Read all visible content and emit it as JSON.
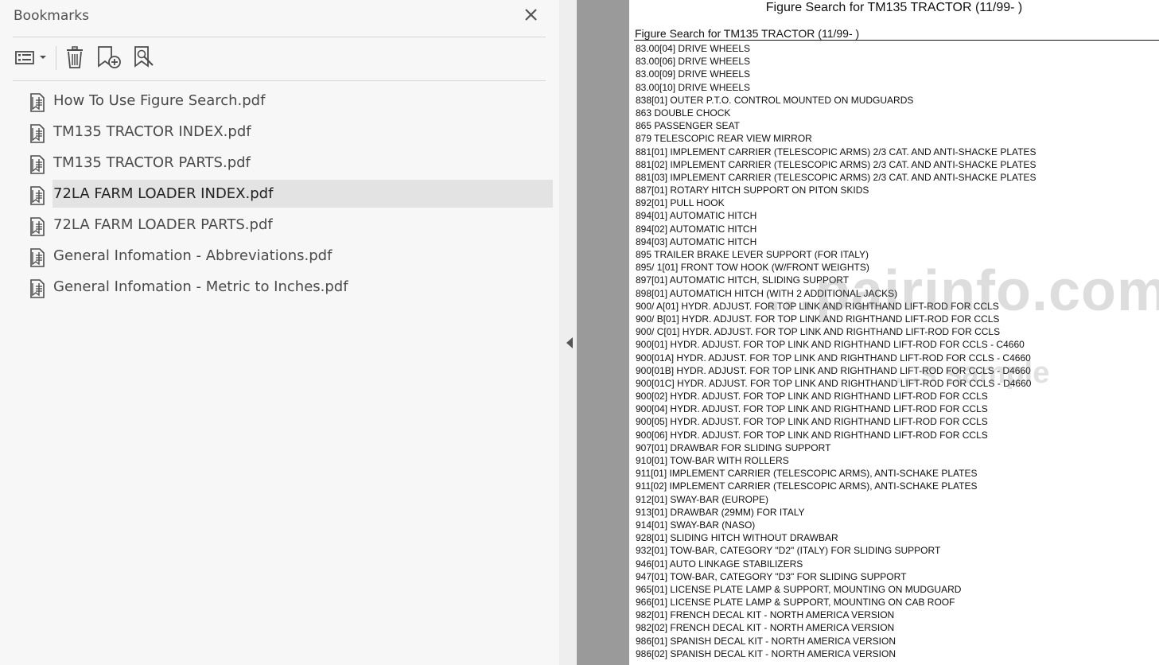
{
  "bookmarks_panel": {
    "title": "Bookmarks",
    "toolbar": [
      {
        "icon": "options-list-icon"
      },
      {
        "icon": "delete-trash-icon"
      },
      {
        "icon": "new-bookmark-icon"
      },
      {
        "icon": "find-bookmark-icon"
      }
    ],
    "items": [
      {
        "label": "How To Use Figure Search.pdf",
        "selected": false
      },
      {
        "label": "TM135 TRACTOR INDEX.pdf",
        "selected": false
      },
      {
        "label": "TM135 TRACTOR PARTS.pdf",
        "selected": false
      },
      {
        "label": "72LA FARM LOADER INDEX.pdf",
        "selected": true
      },
      {
        "label": "72LA FARM LOADER PARTS.pdf",
        "selected": false
      },
      {
        "label": "General Infomation - Abbreviations.pdf",
        "selected": false
      },
      {
        "label": "General Infomation - Metric to Inches.pdf",
        "selected": false
      }
    ]
  },
  "document": {
    "page_title": "Figure Search for TM135 TRACTOR (11/99- )",
    "header": "Figure Search for TM135 TRACTOR (11/99- )",
    "lines": [
      "83.00[04] DRIVE WHEELS",
      "83.00[06] DRIVE WHEELS",
      "83.00[09] DRIVE WHEELS",
      "83.00[10] DRIVE WHEELS",
      "838[01] OUTER P.T.O. CONTROL MOUNTED ON MUDGUARDS",
      "863 DOUBLE CHOCK",
      "865 PASSENGER SEAT",
      "879 TELESCOPIC REAR VIEW MIRROR",
      "881[01] IMPLEMENT CARRIER (TELESCOPIC ARMS) 2/3 CAT. AND ANTI-SHACKE PLATES",
      "881[02] IMPLEMENT CARRIER (TELESCOPIC ARMS) 2/3 CAT. AND ANTI-SHACKE PLATES",
      "881[03] IMPLEMENT CARRIER (TELESCOPIC ARMS) 2/3 CAT. AND ANTI-SHACKE PLATES",
      "887[01] ROTARY HITCH SUPPORT ON PITON SKIDS",
      "892[01] PULL HOOK",
      "894[01] AUTOMATIC HITCH",
      "894[02] AUTOMATIC HITCH",
      "894[03] AUTOMATIC HITCH",
      "895 TRAILER BRAKE LEVER SUPPORT (FOR ITALY)",
      "895/ 1[01] FRONT TOW HOOK (W/FRONT WEIGHTS)",
      "897[01] AUTOMATIC HITCH, SLIDING SUPPORT",
      "898[01] AUTOMATICH HITCH (WITH 2 ADDITIONAL JACKS)",
      "900/  A[01] HYDR. ADJUST. FOR TOP LINK AND RIGHTHAND LIFT-ROD FOR CCLS",
      "900/  B[01] HYDR. ADJUST. FOR TOP LINK AND RIGHTHAND LIFT-ROD FOR CCLS",
      "900/  C[01] HYDR. ADJUST. FOR TOP LINK AND RIGHTHAND LIFT-ROD FOR CCLS",
      "900[01] HYDR. ADJUST. FOR TOP LINK AND RIGHTHAND LIFT-ROD FOR CCLS - C4660",
      "900[01A] HYDR. ADJUST. FOR TOP LINK AND RIGHTHAND LIFT-ROD FOR CCLS - C4660",
      "900[01B] HYDR. ADJUST. FOR TOP LINK AND RIGHTHAND LIFT-ROD FOR CCLS - D4660",
      "900[01C] HYDR. ADJUST. FOR TOP LINK AND RIGHTHAND LIFT-ROD FOR CCLS - D4660",
      "900[02] HYDR. ADJUST. FOR TOP LINK AND RIGHTHAND LIFT-ROD FOR CCLS",
      "900[04] HYDR. ADJUST. FOR TOP LINK AND RIGHTHAND LIFT-ROD FOR CCLS",
      "900[05] HYDR. ADJUST. FOR TOP LINK AND RIGHTHAND LIFT-ROD FOR CCLS",
      "900[06] HYDR. ADJUST. FOR TOP LINK AND RIGHTHAND LIFT-ROD FOR CCLS",
      "907[01] DRAWBAR FOR SLIDING SUPPORT",
      "910[01] TOW-BAR WITH ROLLERS",
      "911[01] IMPLEMENT CARRIER (TELESCOPIC ARMS), ANTI-SCHAKE  PLATES",
      "911[02] IMPLEMENT CARRIER (TELESCOPIC ARMS), ANTI-SCHAKE  PLATES",
      "912[01] SWAY-BAR (EUROPE)",
      "913[01] DRAWBAR (29MM) FOR ITALY",
      "914[01] SWAY-BAR (NASO)",
      "928[01] SLIDING HITCH WITHOUT DRAWBAR",
      "932[01] TOW-BAR, CATEGORY \"D2\" (ITALY) FOR SLIDING SUPPORT",
      "946[01] AUTO LINKAGE STABILIZERS",
      "947[01] TOW-BAR, CATEGORY \"D3\" FOR SLIDING SUPPORT",
      "965[01] LICENSE PLATE LAMP & SUPPORT, MOUNTING ON MUDGUARD",
      "966[01] LICENSE PLATE LAMP & SUPPORT, MOUNTING ON CAB ROOF",
      "982[01] FRENCH DECAL KIT - NORTH AMERICA VERSION",
      "982[02] FRENCH DECAL KIT - NORTH AMERICA VERSION",
      "986[01] SPANISH DECAL KIT - NORTH AMERICA VERSION",
      "986[02] SPANISH DECAL KIT - NORTH AMERICA VERSION"
    ]
  },
  "watermark": {
    "main": "...pairinfo.com",
    "sub": "...s sample"
  },
  "colors": {
    "panel_bg": "#f7f7f7",
    "selected_bg": "#e3e3e3",
    "gutter": "#9a9a9a",
    "icon": "#4d4d4d"
  }
}
